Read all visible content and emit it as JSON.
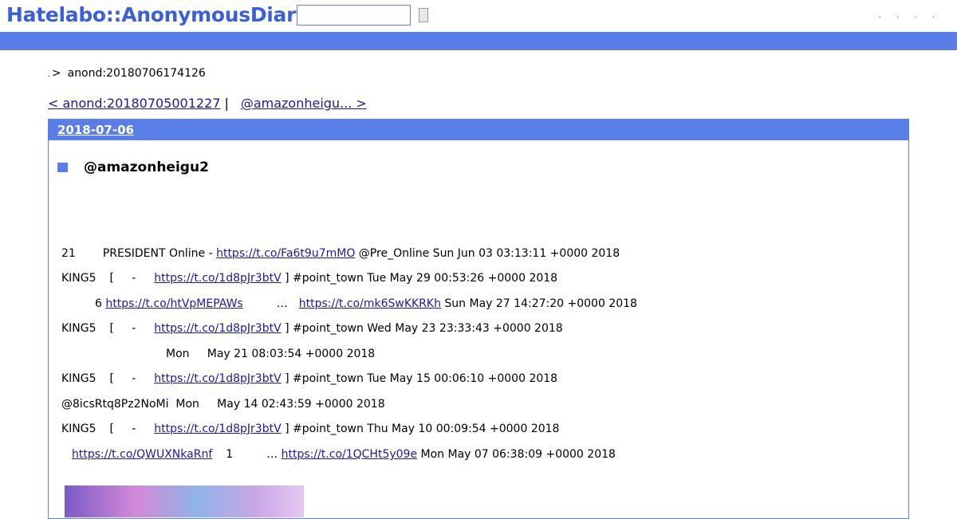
{
  "header": {
    "logo": "Hatelabo::AnonymousDiary",
    "search_value": "",
    "search_button": "",
    "links": [
      ".",
      ".",
      ".",
      "."
    ]
  },
  "breadcrumb": {
    "home": ".",
    "sep": ">",
    "current": "anond:20180706174126"
  },
  "nav": {
    "prev": "< anond:20180705001227",
    "divider": "|",
    "next": "@amazonheigu... >"
  },
  "entry": {
    "date": "2018-07-06",
    "title": "@amazonheigu2"
  },
  "tweets": [
    {
      "pre": "21",
      "mid": "PRESIDENT Online - ",
      "link": "https://t.co/Fa6t9u7mMO",
      "post": " @Pre_Online Sun Jun 03 03:13:11 +0000 2018"
    },
    {
      "pre": "KING5",
      "mid": "[     -  ",
      "link": "https://t.co/1d8pJr3btV",
      "post": " ] #point_town Tue May 29 00:53:26 +0000 2018"
    },
    {
      "pre": "6",
      "link": "https://t.co/htVpMEPAWs",
      "mid2": "…",
      "link2": "https://t.co/mk6SwKKRKh",
      "post": " Sun May 27 14:27:20 +0000 2018"
    },
    {
      "pre": "KING5",
      "mid": "[     -  ",
      "link": "https://t.co/1d8pJr3btV",
      "post": " ] #point_town Wed May 23 23:33:43 +0000 2018"
    },
    {
      "text": "Mon     May 21 08:03:54 +0000 2018"
    },
    {
      "pre": "KING5",
      "mid": "[     -  ",
      "link": "https://t.co/1d8pJr3btV",
      "post": " ] #point_town Tue May 15 00:06:10 +0000 2018"
    },
    {
      "text": "@8icsRtq8Pz2NoMi  Mon     May 14 02:43:59 +0000 2018"
    },
    {
      "pre": "KING5",
      "mid": "[     -  ",
      "link": "https://t.co/1d8pJr3btV",
      "post": " ] #point_town Thu May 10 00:09:54 +0000 2018"
    },
    {
      "link": "https://t.co/QWUXNkaRnf",
      "mid": "1",
      "mid2": "…",
      "link2": "https://t.co/1QCHt5y09e",
      "post": " Mon May 07 06:38:09 +0000 2018"
    }
  ],
  "colors": {
    "accent": "#5a7ee8",
    "link": "#1a1a9c"
  }
}
